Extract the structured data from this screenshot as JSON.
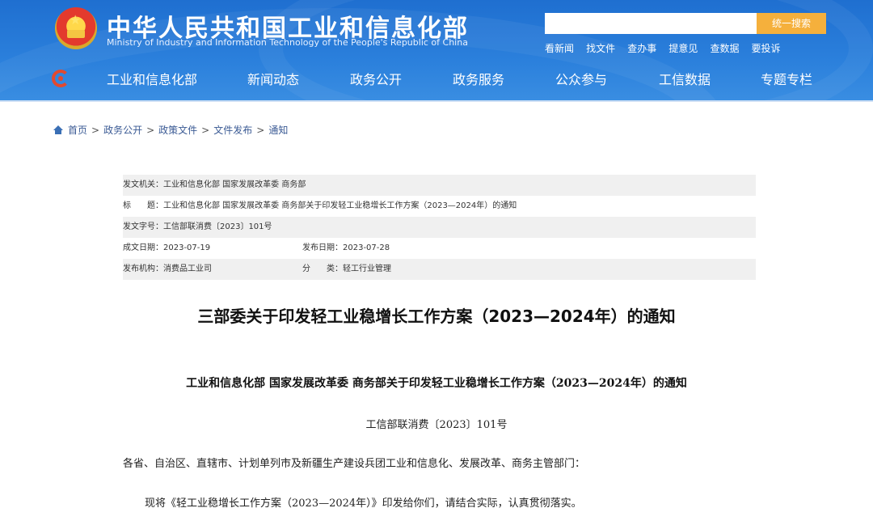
{
  "header": {
    "site_title": "中华人民共和国工业和信息化部",
    "site_subtitle": "Ministry of Industry and Information Technology of the People's Republic of China",
    "search": {
      "value": "",
      "placeholder": "",
      "button_label": "统一搜索"
    },
    "quick_links": [
      "看新闻",
      "找文件",
      "查办事",
      "提意见",
      "查数据",
      "要投诉"
    ]
  },
  "nav": {
    "items": [
      "工业和信息化部",
      "新闻动态",
      "政务公开",
      "政务服务",
      "公众参与",
      "工信数据",
      "专题专栏"
    ]
  },
  "breadcrumb": {
    "items": [
      "首页",
      "政务公开",
      "政策文件",
      "文件发布",
      "通知"
    ],
    "separator": ">"
  },
  "meta": {
    "issuer_label": "发文机关：",
    "issuer_value": "工业和信息化部 国家发展改革委 商务部",
    "title_label": "标　　题：",
    "title_value": "工业和信息化部 国家发展改革委 商务部关于印发轻工业稳增长工作方案（2023—2024年）的通知",
    "doc_no_label": "发文字号：",
    "doc_no_value": "工信部联消费〔2023〕101号",
    "created_label": "成文日期：",
    "created_value": "2023-07-19",
    "published_label": "发布日期：",
    "published_value": "2023-07-28",
    "org_label": "发布机构：",
    "org_value": "消费品工业司",
    "category_label": "分　　类：",
    "category_value": "轻工行业管理"
  },
  "article": {
    "title": "三部委关于印发轻工业稳增长工作方案（2023—2024年）的通知",
    "doc_heading": "工业和信息化部 国家发展改革委 商务部关于印发轻工业稳增长工作方案（2023—2024年）的通知",
    "doc_number": "工信部联消费〔2023〕101号",
    "salutation": "各省、自治区、直辖市、计划单列市及新疆生产建设兵团工业和信息化、发展改革、商务主管部门：",
    "body": "现将《轻工业稳增长工作方案（2023—2024年）》印发给你们，请结合实际，认真贯彻落实。"
  },
  "colors": {
    "header_blue": "#2b80dc",
    "search_button": "#f5b03c",
    "link_blue": "#3a5a94"
  }
}
